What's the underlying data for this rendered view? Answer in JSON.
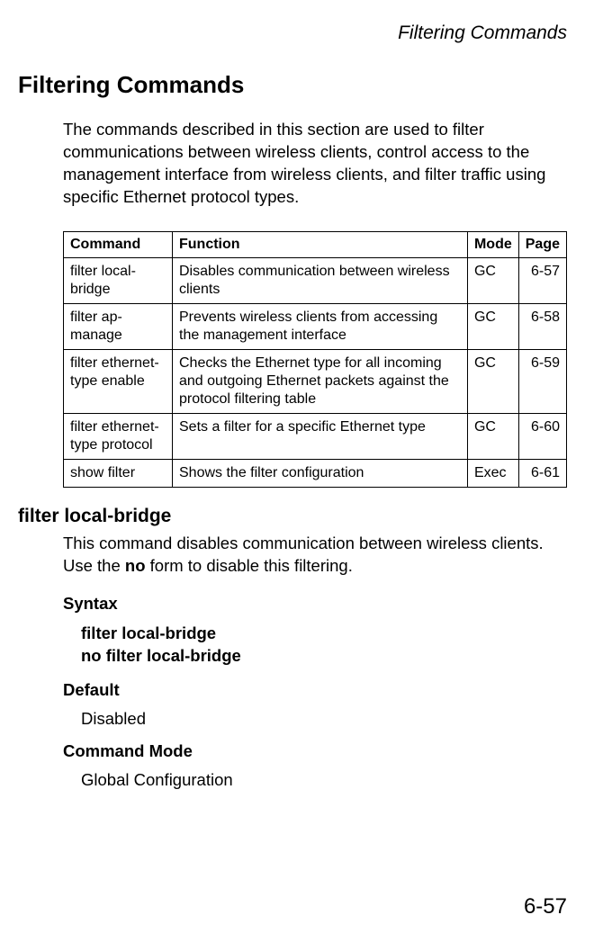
{
  "header": {
    "runningTitle": "Filtering Commands"
  },
  "mainHeading": "Filtering Commands",
  "introText": "The commands described in this section are used to filter communications between wireless clients, control access to the management interface from wireless clients, and filter traffic using specific Ethernet protocol types.",
  "table": {
    "headers": {
      "command": "Command",
      "function": "Function",
      "mode": "Mode",
      "page": "Page"
    },
    "rows": [
      {
        "command": "filter local-bridge",
        "function": "Disables communication between wireless clients",
        "mode": "GC",
        "page": "6-57"
      },
      {
        "command": "filter ap-manage",
        "function": "Prevents wireless clients from accessing the management interface",
        "mode": "GC",
        "page": "6-58"
      },
      {
        "command": "filter ethernet-type enable",
        "function": "Checks the Ethernet type for all incoming and outgoing Ethernet packets against the protocol filtering table",
        "mode": "GC",
        "page": "6-59"
      },
      {
        "command": "filter ethernet-type protocol",
        "function": "Sets a filter for a specific Ethernet type",
        "mode": "GC",
        "page": "6-60"
      },
      {
        "command": "show filter",
        "function": "Shows the filter configuration",
        "mode": "Exec",
        "page": "6-61"
      }
    ]
  },
  "commandDetail": {
    "heading": "filter local-bridge",
    "descriptionPart1": "This command disables communication between wireless clients. Use the ",
    "descriptionBold": "no",
    "descriptionPart2": " form to disable this filtering.",
    "syntaxLabel": "Syntax",
    "syntaxLine1": "filter local-bridge",
    "syntaxLine2": "no filter local-bridge",
    "defaultLabel": "Default",
    "defaultValue": "Disabled",
    "commandModeLabel": "Command Mode",
    "commandModeValue": "Global Configuration"
  },
  "pageNumber": "6-57"
}
